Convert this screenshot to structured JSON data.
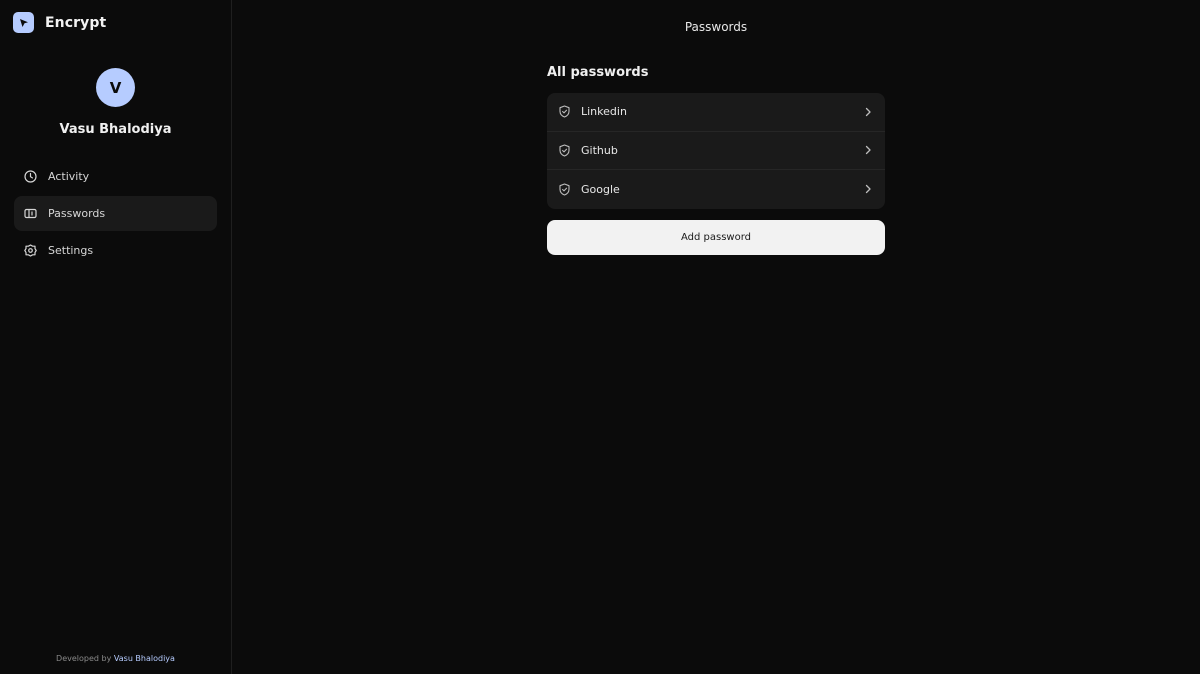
{
  "brand": {
    "name": "Encrypt",
    "logo_icon": "play-arrow-icon"
  },
  "profile": {
    "initial": "V",
    "name": "Vasu Bhalodiya"
  },
  "nav": [
    {
      "label": "Activity",
      "icon": "clock-icon",
      "active": false
    },
    {
      "label": "Passwords",
      "icon": "passwords-icon",
      "active": true
    },
    {
      "label": "Settings",
      "icon": "gear-icon",
      "active": false
    }
  ],
  "footer": {
    "prefix": "Developed by",
    "author": "Vasu Bhalodiya"
  },
  "main": {
    "title": "Passwords",
    "section_title": "All passwords",
    "items": [
      {
        "label": "Linkedin",
        "icon": "shield-check-icon"
      },
      {
        "label": "Github",
        "icon": "shield-check-icon"
      },
      {
        "label": "Google",
        "icon": "shield-check-icon"
      }
    ],
    "add_button_label": "Add password"
  },
  "colors": {
    "background": "#0b0b0b",
    "accent": "#b6ccff",
    "surface": "#1a1a1a",
    "button": "#f2f2f2"
  }
}
